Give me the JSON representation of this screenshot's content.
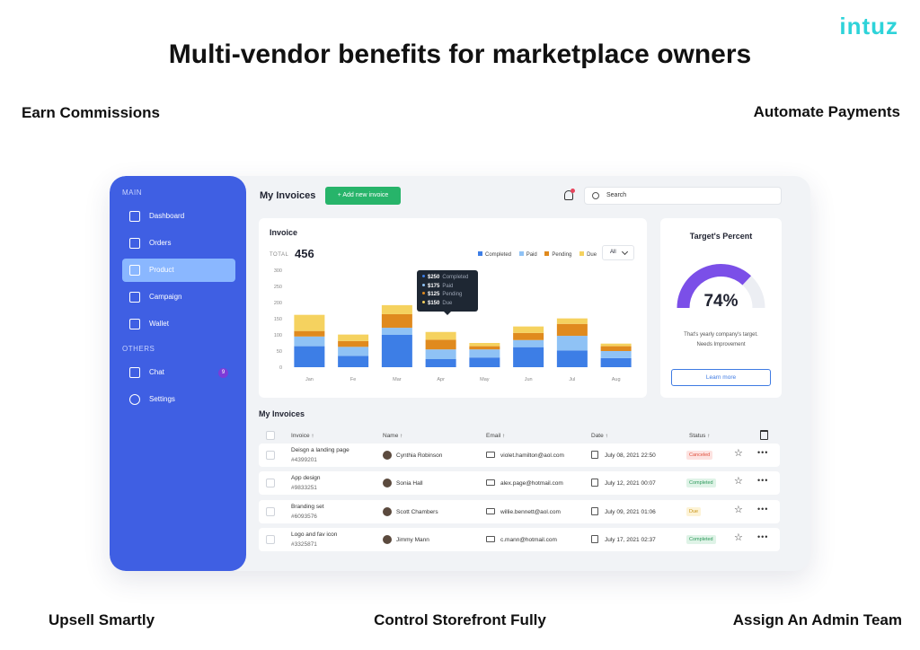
{
  "brand": "intuz",
  "headline": "Multi-vendor benefits for marketplace owners",
  "benefits": {
    "earn": "Earn Commissions",
    "automate": "Automate Payments",
    "upsell": "Upsell Smartly",
    "control": "Control Storefront Fully",
    "assign": "Assign An Admin Team"
  },
  "sidebar": {
    "main_label": "MAIN",
    "others_label": "OTHERS",
    "main_items": [
      {
        "label": "Dashboard",
        "icon": "chart-icon"
      },
      {
        "label": "Orders",
        "icon": "bag-icon"
      },
      {
        "label": "Product",
        "icon": "box-icon",
        "active": true
      },
      {
        "label": "Campaign",
        "icon": "calendar-icon"
      },
      {
        "label": "Wallet",
        "icon": "wallet-icon"
      }
    ],
    "other_items": [
      {
        "label": "Chat",
        "icon": "chat-icon",
        "badge": "9"
      },
      {
        "label": "Settings",
        "icon": "gear-icon"
      }
    ]
  },
  "topbar": {
    "title": "My Invoices",
    "add_button": "+ Add new invoice",
    "search_placeholder": "Search"
  },
  "invoice_card": {
    "title": "Invoice",
    "total_label": "TOTAL",
    "total_value": "456",
    "range": "All",
    "legend": [
      "Completed",
      "Paid",
      "Pending",
      "Due"
    ],
    "colors": [
      "#3d7ee6",
      "#8fc2f5",
      "#e08a1e",
      "#f5d25f"
    ]
  },
  "chart_data": {
    "type": "bar",
    "stacked": true,
    "categories": [
      "Jan",
      "Fe",
      "Mar",
      "Apr",
      "May",
      "Jun",
      "Jul",
      "Aug"
    ],
    "series": [
      {
        "name": "Completed",
        "values": [
          65,
          35,
          100,
          25,
          30,
          62,
          52,
          28
        ]
      },
      {
        "name": "Paid",
        "values": [
          30,
          28,
          22,
          30,
          25,
          22,
          45,
          22
        ]
      },
      {
        "name": "Pending",
        "values": [
          17,
          18,
          42,
          30,
          10,
          22,
          37,
          15
        ]
      },
      {
        "name": "Due",
        "values": [
          50,
          20,
          28,
          24,
          10,
          20,
          17,
          8
        ]
      }
    ],
    "yticks": [
      "0",
      "50",
      "100",
      "150",
      "200",
      "250",
      "300"
    ],
    "ylim": [
      0,
      300
    ],
    "tooltip": [
      {
        "value": "$250",
        "label": "Completed"
      },
      {
        "value": "$175",
        "label": "Paid"
      },
      {
        "value": "$125",
        "label": "Pending"
      },
      {
        "value": "$150",
        "label": "Due"
      }
    ]
  },
  "target_card": {
    "title": "Target's Percent",
    "percent_text": "74%",
    "percent": 0.74,
    "desc_line1": "That's yearly company's target.",
    "desc_line2": "Needs Improvement",
    "button": "Learn more",
    "gauge_color": "#7b4fe8",
    "track_color": "#eceef3"
  },
  "table": {
    "title": "My Invoices",
    "headers": [
      "Invoice ↑",
      "Name ↑",
      "Email ↑",
      "Date ↑",
      "Status ↑"
    ],
    "rows": [
      {
        "invoice": "Deisgn a landing page",
        "id": "#4399201",
        "name": "Cynthia Robinson",
        "email": "violet.hamilton@aol.com",
        "date": "July 08, 2021 22:50",
        "status": "Canceled",
        "status_bg": "#fde3e1",
        "status_color": "#e0513e"
      },
      {
        "invoice": "App design",
        "id": "#9833251",
        "name": "Sonia Hall",
        "email": "alex.page@hotmail.com",
        "date": "July 12, 2021 00:07",
        "status": "Completed",
        "status_bg": "#dff3e7",
        "status_color": "#2e9a5c"
      },
      {
        "invoice": "Branding set",
        "id": "#6093576",
        "name": "Scott Chambers",
        "email": "willie.bennett@aol.com",
        "date": "July 09, 2021 01:06",
        "status": "Due",
        "status_bg": "#fdf3d6",
        "status_color": "#c99518"
      },
      {
        "invoice": "Logo and fav icon",
        "id": "#3325871",
        "name": "Jimmy Mann",
        "email": "c.mann@hotmail.com",
        "date": "July 17, 2021 02:37",
        "status": "Completed",
        "status_bg": "#dff3e7",
        "status_color": "#2e9a5c"
      }
    ]
  }
}
